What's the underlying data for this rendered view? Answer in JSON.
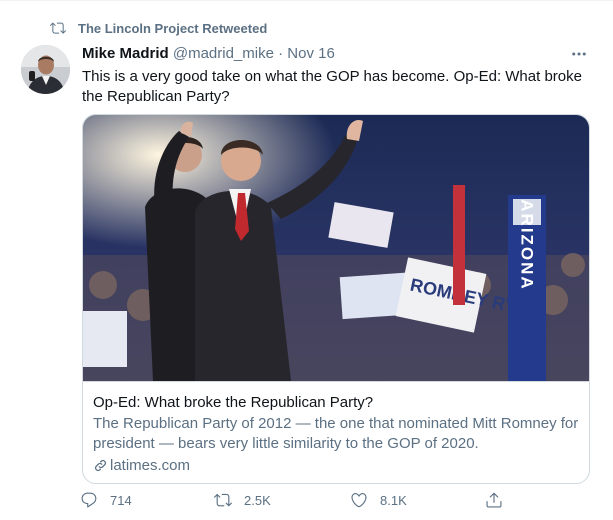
{
  "retweet": {
    "label": "The Lincoln Project Retweeted",
    "icon": "retweet-icon"
  },
  "author": {
    "name": "Mike Madrid",
    "handle": "@madrid_mike",
    "separator": "·",
    "date": "Nov 16"
  },
  "tweet": {
    "text": "This is a very good take on what the GOP has become. Op-Ed: What broke the Republican Party?"
  },
  "card": {
    "image_signs": {
      "arizona": "ARIZONA",
      "romney_ryan": "ROMNEY RYAN"
    },
    "title": "Op-Ed: What broke the Republican Party?",
    "description": "The Republican Party of 2012 — the one that nominated Mitt Romney for president — bears very little similarity to the GOP of 2020.",
    "domain": "latimes.com"
  },
  "actions": {
    "reply_count": "714",
    "retweet_count": "2.5K",
    "like_count": "8.1K"
  },
  "colors": {
    "secondary_text": "#5b7083",
    "border": "#cfd9de",
    "primary_text": "#0f1419"
  }
}
